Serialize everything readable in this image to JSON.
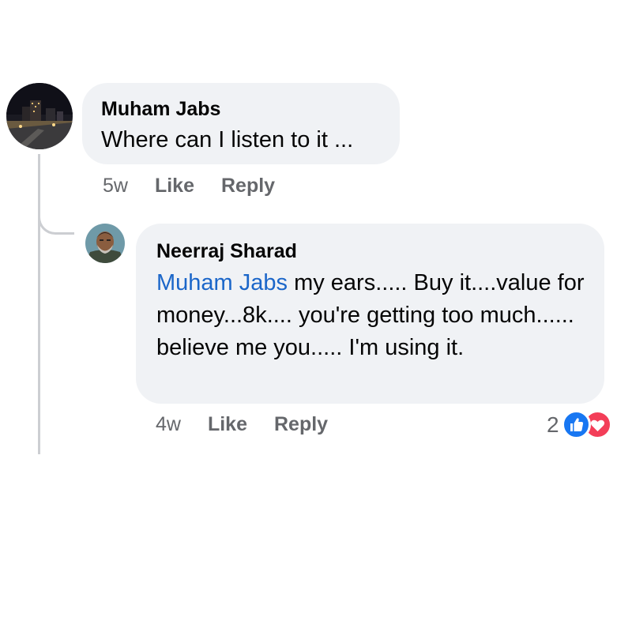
{
  "comment": {
    "author": "Muham Jabs",
    "text": "Where can I listen to it ...",
    "time": "5w",
    "like_label": "Like",
    "reply_label": "Reply"
  },
  "reply": {
    "author": "Neerraj Sharad",
    "mention": "Muham Jabs",
    "text": " my ears..... Buy it....value for money...8k.... you're getting too much...... believe me you..... I'm using it.",
    "time": "4w",
    "like_label": "Like",
    "reply_label": "Reply",
    "reaction_count": "2",
    "reactions": [
      "like-icon",
      "love-icon"
    ]
  },
  "colors": {
    "bubble": "#f0f2f5",
    "mention": "#1b66c9",
    "meta": "#65676b",
    "like": "#1877f2",
    "love": "#f33e58"
  }
}
